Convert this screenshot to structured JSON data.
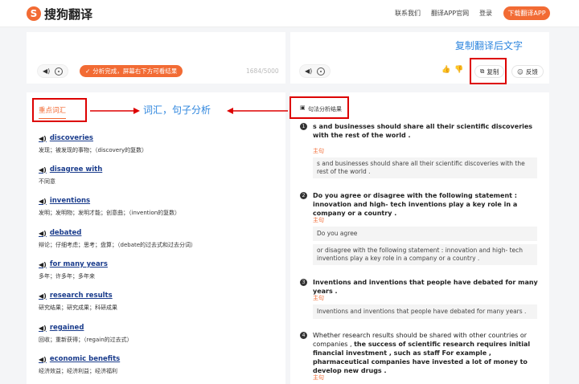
{
  "header": {
    "logo_text": "搜狗翻译",
    "nav": [
      "联系我们",
      "翻译APP官网",
      "登录"
    ],
    "download_btn": "下载翻译APP"
  },
  "source": {
    "status": "分析完成，屏幕右下方可看结果",
    "count": "1684/5000"
  },
  "target": {
    "copy": "复制",
    "feedback": "反馈"
  },
  "annotations": {
    "copy_note": "复制翻译后文字",
    "analysis_note": "词汇，句子分析"
  },
  "left_panel": {
    "title": "重点词汇"
  },
  "vocab": [
    {
      "word": "discoveries",
      "def": "发现；被发现的事物；（discovery的复数）"
    },
    {
      "word": "disagree with",
      "def": "不同意"
    },
    {
      "word": "inventions",
      "def": "发明；发明物；发明才能；创意曲；（invention的复数）"
    },
    {
      "word": "debated",
      "def": "辩论；仔细考虑；思考；盘算；（debate的过去式和过去分词）"
    },
    {
      "word": "for many years",
      "def": "多年；许多年；多年来"
    },
    {
      "word": "research results",
      "def": "研究结果；研究成果；科研成果"
    },
    {
      "word": "regained",
      "def": "回收；重新获得；（regain的过去式）"
    },
    {
      "word": "economic benefits",
      "def": "经济效益；经济利益；经济福利"
    }
  ],
  "right_panel": {
    "title": "句法分析结果"
  },
  "sentences": [
    {
      "num": "1",
      "text": "s and businesses should share all their scientific discoveries with the rest of the world .",
      "tag": "主句",
      "parts": [
        "s and businesses should share all their scientific discoveries with the rest of the world ."
      ]
    },
    {
      "num": "2",
      "text": "Do you agree or disagree with the following statement : innovation and high- tech inventions play a key role in a company or a country .",
      "tag": "主句",
      "parts": [
        "Do you agree",
        "or disagree with the following statement : innovation and high- tech inventions play a key role in a company or a country ."
      ]
    },
    {
      "num": "3",
      "text": "Inventions and inventions that people have debated for many years .",
      "tag": "主句",
      "parts": [
        "Inventions and inventions that people have debated for many years ."
      ]
    },
    {
      "num": "4",
      "text_plain": "Whether research results should be shared with other countries or companies ,",
      "text_bold": "the success of scientific research requires initial financial investment , such as staff For example , pharmaceutical companies have invested a lot of money to develop new drugs .",
      "tag": "主句"
    }
  ]
}
